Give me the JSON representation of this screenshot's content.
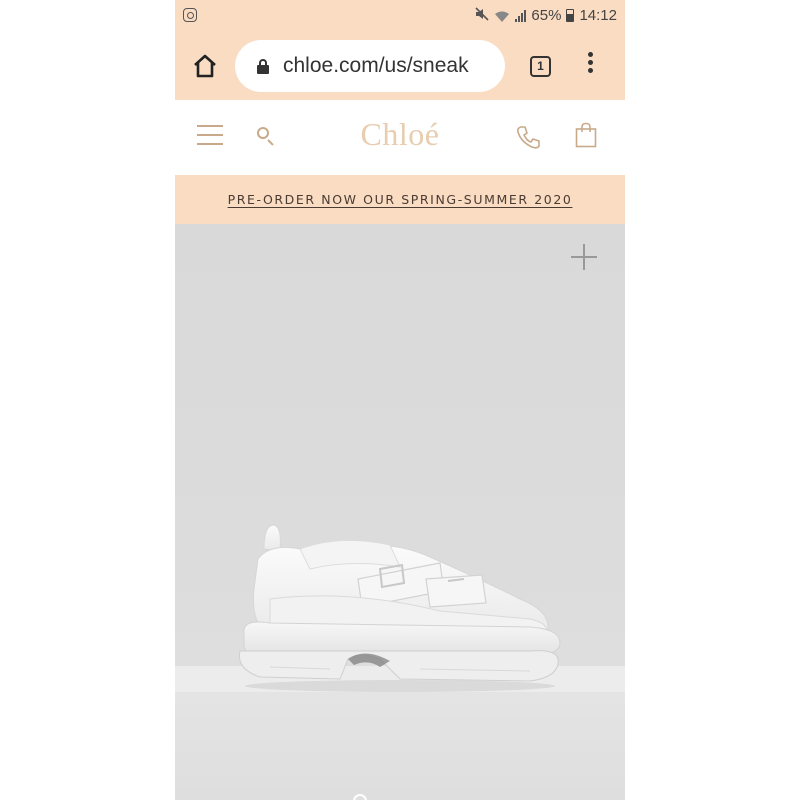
{
  "status_bar": {
    "battery_text": "65%",
    "time": "14:12",
    "icons": [
      "instagram-icon",
      "mute-icon",
      "wifi-icon",
      "signal-icon",
      "battery-icon"
    ]
  },
  "browser": {
    "url": "chloe.com/us/sneak",
    "tab_count": "1",
    "icons": [
      "home-icon",
      "lock-icon",
      "more-vert-icon"
    ]
  },
  "site_header": {
    "logo": "Chloé",
    "icons": [
      "hamburger-icon",
      "search-icon",
      "phone-icon",
      "shopping-bag-icon"
    ]
  },
  "promo": {
    "text": "PRE-ORDER NOW OUR SPRING-SUMMER 2020"
  },
  "product": {
    "icons": [
      "plus-icon"
    ]
  },
  "colors": {
    "accent_peach": "#fadcc2",
    "brand_logo": "#e8cdb0",
    "icon_tan": "#c8a98a",
    "product_bg": "#dadada"
  }
}
